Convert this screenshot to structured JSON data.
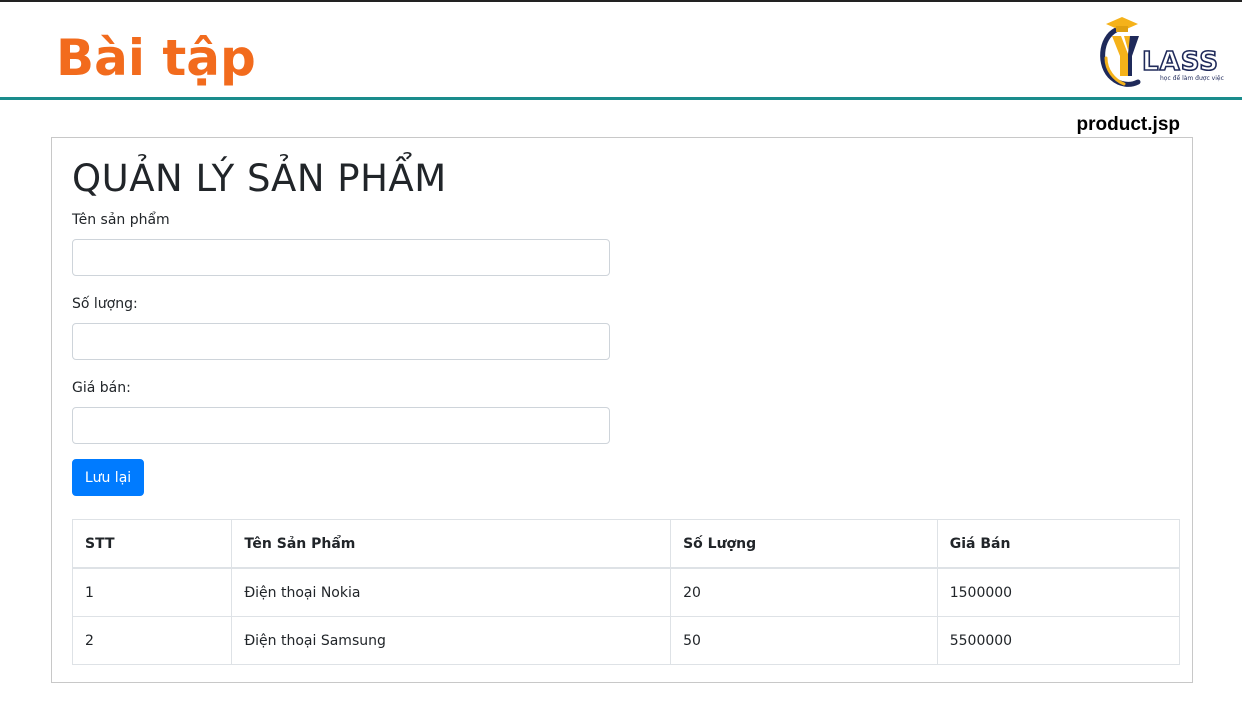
{
  "slide": {
    "title": "Bài tập",
    "file_label": "product.jsp"
  },
  "logo": {
    "wordmark": "LASS",
    "tagline": "học để làm được việc"
  },
  "form": {
    "heading": "QUẢN LÝ SẢN PHẨM",
    "fields": [
      {
        "label": "Tên sản phẩm",
        "value": "",
        "placeholder": ""
      },
      {
        "label": "Số lượng:",
        "value": "",
        "placeholder": ""
      },
      {
        "label": "Giá bán:",
        "value": "",
        "placeholder": ""
      }
    ],
    "save_label": "Lưu lại"
  },
  "table": {
    "headers": [
      "STT",
      "Tên Sản Phẩm",
      "Số Lượng",
      "Giá Bán"
    ],
    "rows": [
      [
        "1",
        "Điện thoại Nokia",
        "20",
        "1500000"
      ],
      [
        "2",
        "Điện thoại Samsung",
        "50",
        "5500000"
      ]
    ]
  },
  "colors": {
    "title": "#f26b1d",
    "rule": "#1a8c8c",
    "button": "#007bff",
    "logo_navy": "#1f2a5a",
    "logo_gold": "#f5b21a"
  }
}
